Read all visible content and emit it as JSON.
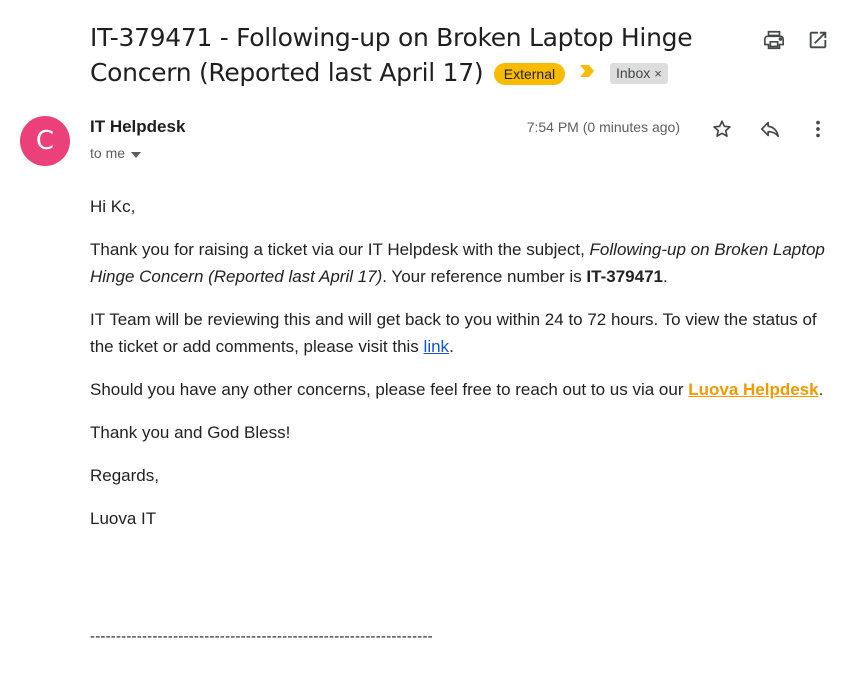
{
  "email": {
    "subject": "IT-379471 - Following-up on Broken Laptop Hinge Concern (Reported last April 17)",
    "labels": {
      "external": "External",
      "inbox": "Inbox",
      "inbox_remove": "×"
    },
    "sender_initial": "C",
    "sender_name": "IT Helpdesk",
    "recipient": "to me",
    "timestamp": "7:54 PM (0 minutes ago)",
    "body": {
      "greeting": "Hi Kc,",
      "p1_prefix": "Thank you for raising a ticket via our IT Helpdesk with the subject, ",
      "p1_subject": "Following-up on Broken Laptop Hinge Concern (Reported last April 17)",
      "p1_mid": ". Your reference number is ",
      "p1_ref": "IT-379471",
      "p1_end": ".",
      "p2_prefix": "IT Team will be reviewing this and will get back to you within 24 to 72 hours. To view the status of the ticket or add comments, please visit this ",
      "p2_link": "link",
      "p2_end": ".",
      "p3_prefix": "Should you have any other concerns, please feel free to reach out to us via our ",
      "p3_link": "Luova Helpdesk",
      "p3_end": ".",
      "thanks": "Thank you and God Bless!",
      "regards": "Regards,",
      "signature": "Luova IT",
      "separator": "------------------------------------------------------------------"
    }
  },
  "icons": {
    "print": "print-icon",
    "open_new_window": "open-in-new-window-icon",
    "star": "star-icon",
    "reply": "reply-icon",
    "more": "more-vertical-icon",
    "caret": "chevron-down-icon",
    "importance": "importance-marker-icon"
  },
  "colors": {
    "external_label": "#f9bb00",
    "avatar": "#ec407a",
    "link": "#1155cc",
    "helpdesk_link": "#f29900"
  }
}
